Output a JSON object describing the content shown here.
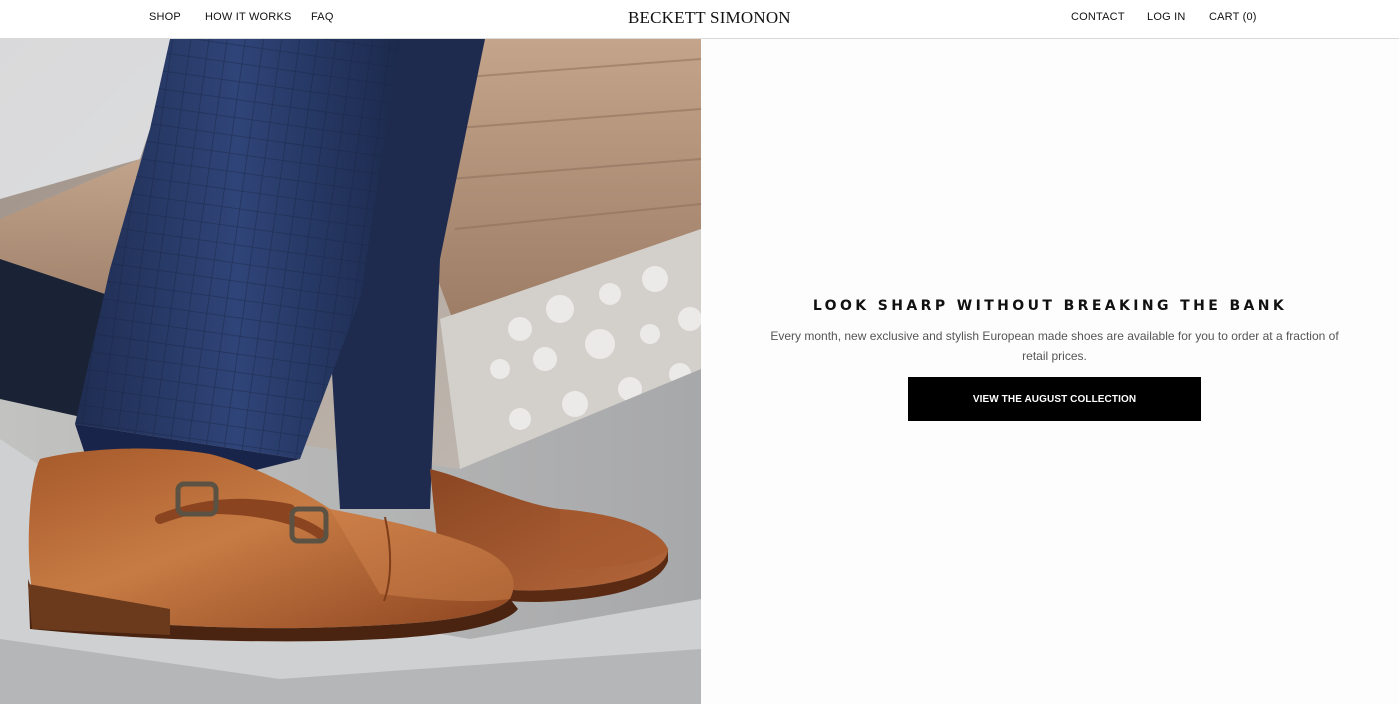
{
  "header": {
    "nav_left": {
      "shop": "SHOP",
      "how_it_works": "HOW IT WORKS",
      "faq": "FAQ"
    },
    "logo": "BECKETT SIMONON",
    "nav_right": {
      "contact": "CONTACT",
      "login": "LOG IN",
      "cart": "CART (0)"
    }
  },
  "hero": {
    "headline": "LOOK SHARP WITHOUT BREAKING THE BANK",
    "subtext": "Every month, new exclusive and stylish European made shoes are available for you to order at a fraction of retail prices.",
    "cta_label": "VIEW THE AUGUST COLLECTION"
  },
  "colors": {
    "cta_background": "#000000",
    "cta_text": "#ffffff",
    "trouser_navy": "#2b3d6b",
    "shoe_tan": "#b5652f"
  }
}
